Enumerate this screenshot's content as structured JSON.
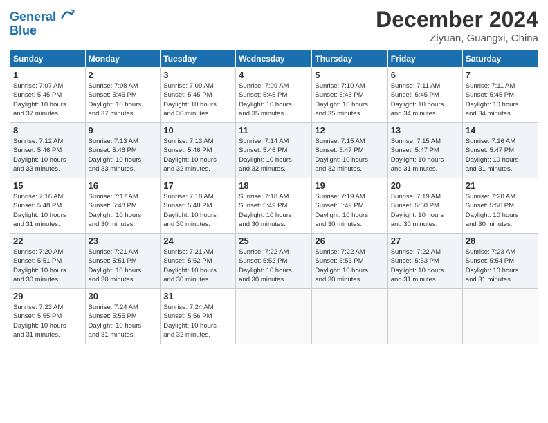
{
  "header": {
    "logo_line1": "General",
    "logo_line2": "Blue",
    "title": "December 2024",
    "subtitle": "Ziyuan, Guangxi, China"
  },
  "weekdays": [
    "Sunday",
    "Monday",
    "Tuesday",
    "Wednesday",
    "Thursday",
    "Friday",
    "Saturday"
  ],
  "weeks": [
    [
      {
        "day": "1",
        "info": "Sunrise: 7:07 AM\nSunset: 5:45 PM\nDaylight: 10 hours\nand 37 minutes."
      },
      {
        "day": "2",
        "info": "Sunrise: 7:08 AM\nSunset: 5:45 PM\nDaylight: 10 hours\nand 37 minutes."
      },
      {
        "day": "3",
        "info": "Sunrise: 7:09 AM\nSunset: 5:45 PM\nDaylight: 10 hours\nand 36 minutes."
      },
      {
        "day": "4",
        "info": "Sunrise: 7:09 AM\nSunset: 5:45 PM\nDaylight: 10 hours\nand 35 minutes."
      },
      {
        "day": "5",
        "info": "Sunrise: 7:10 AM\nSunset: 5:45 PM\nDaylight: 10 hours\nand 35 minutes."
      },
      {
        "day": "6",
        "info": "Sunrise: 7:11 AM\nSunset: 5:45 PM\nDaylight: 10 hours\nand 34 minutes."
      },
      {
        "day": "7",
        "info": "Sunrise: 7:11 AM\nSunset: 5:45 PM\nDaylight: 10 hours\nand 34 minutes."
      }
    ],
    [
      {
        "day": "8",
        "info": "Sunrise: 7:12 AM\nSunset: 5:46 PM\nDaylight: 10 hours\nand 33 minutes."
      },
      {
        "day": "9",
        "info": "Sunrise: 7:13 AM\nSunset: 5:46 PM\nDaylight: 10 hours\nand 33 minutes."
      },
      {
        "day": "10",
        "info": "Sunrise: 7:13 AM\nSunset: 5:46 PM\nDaylight: 10 hours\nand 32 minutes."
      },
      {
        "day": "11",
        "info": "Sunrise: 7:14 AM\nSunset: 5:46 PM\nDaylight: 10 hours\nand 32 minutes."
      },
      {
        "day": "12",
        "info": "Sunrise: 7:15 AM\nSunset: 5:47 PM\nDaylight: 10 hours\nand 32 minutes."
      },
      {
        "day": "13",
        "info": "Sunrise: 7:15 AM\nSunset: 5:47 PM\nDaylight: 10 hours\nand 31 minutes."
      },
      {
        "day": "14",
        "info": "Sunrise: 7:16 AM\nSunset: 5:47 PM\nDaylight: 10 hours\nand 31 minutes."
      }
    ],
    [
      {
        "day": "15",
        "info": "Sunrise: 7:16 AM\nSunset: 5:48 PM\nDaylight: 10 hours\nand 31 minutes."
      },
      {
        "day": "16",
        "info": "Sunrise: 7:17 AM\nSunset: 5:48 PM\nDaylight: 10 hours\nand 30 minutes."
      },
      {
        "day": "17",
        "info": "Sunrise: 7:18 AM\nSunset: 5:48 PM\nDaylight: 10 hours\nand 30 minutes."
      },
      {
        "day": "18",
        "info": "Sunrise: 7:18 AM\nSunset: 5:49 PM\nDaylight: 10 hours\nand 30 minutes."
      },
      {
        "day": "19",
        "info": "Sunrise: 7:19 AM\nSunset: 5:49 PM\nDaylight: 10 hours\nand 30 minutes."
      },
      {
        "day": "20",
        "info": "Sunrise: 7:19 AM\nSunset: 5:50 PM\nDaylight: 10 hours\nand 30 minutes."
      },
      {
        "day": "21",
        "info": "Sunrise: 7:20 AM\nSunset: 5:50 PM\nDaylight: 10 hours\nand 30 minutes."
      }
    ],
    [
      {
        "day": "22",
        "info": "Sunrise: 7:20 AM\nSunset: 5:51 PM\nDaylight: 10 hours\nand 30 minutes."
      },
      {
        "day": "23",
        "info": "Sunrise: 7:21 AM\nSunset: 5:51 PM\nDaylight: 10 hours\nand 30 minutes."
      },
      {
        "day": "24",
        "info": "Sunrise: 7:21 AM\nSunset: 5:52 PM\nDaylight: 10 hours\nand 30 minutes."
      },
      {
        "day": "25",
        "info": "Sunrise: 7:22 AM\nSunset: 5:52 PM\nDaylight: 10 hours\nand 30 minutes."
      },
      {
        "day": "26",
        "info": "Sunrise: 7:22 AM\nSunset: 5:53 PM\nDaylight: 10 hours\nand 30 minutes."
      },
      {
        "day": "27",
        "info": "Sunrise: 7:22 AM\nSunset: 5:53 PM\nDaylight: 10 hours\nand 31 minutes."
      },
      {
        "day": "28",
        "info": "Sunrise: 7:23 AM\nSunset: 5:54 PM\nDaylight: 10 hours\nand 31 minutes."
      }
    ],
    [
      {
        "day": "29",
        "info": "Sunrise: 7:23 AM\nSunset: 5:55 PM\nDaylight: 10 hours\nand 31 minutes."
      },
      {
        "day": "30",
        "info": "Sunrise: 7:24 AM\nSunset: 5:55 PM\nDaylight: 10 hours\nand 31 minutes."
      },
      {
        "day": "31",
        "info": "Sunrise: 7:24 AM\nSunset: 5:56 PM\nDaylight: 10 hours\nand 32 minutes."
      },
      null,
      null,
      null,
      null
    ]
  ]
}
